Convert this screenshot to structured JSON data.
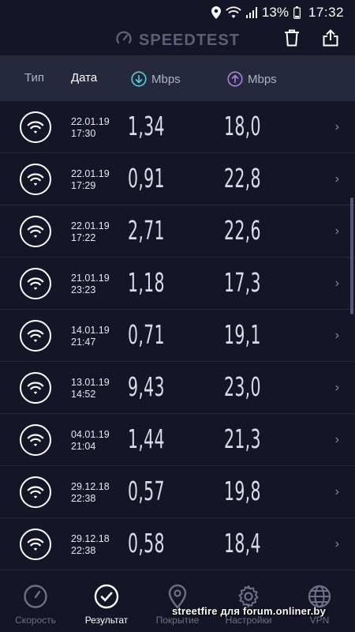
{
  "status_bar": {
    "battery": "13%",
    "time": "17:32"
  },
  "header": {
    "title": "SPEEDTEST"
  },
  "columns": {
    "type": "Тип",
    "date": "Дата",
    "download": "Mbps",
    "upload": "Mbps"
  },
  "results": [
    {
      "date": "22.01.19",
      "time": "17:30",
      "download": "1,34",
      "upload": "18,0"
    },
    {
      "date": "22.01.19",
      "time": "17:29",
      "download": "0,91",
      "upload": "22,8"
    },
    {
      "date": "22.01.19",
      "time": "17:22",
      "download": "2,71",
      "upload": "22,6"
    },
    {
      "date": "21.01.19",
      "time": "23:23",
      "download": "1,18",
      "upload": "17,3"
    },
    {
      "date": "14.01.19",
      "time": "21:47",
      "download": "0,71",
      "upload": "19,1"
    },
    {
      "date": "13.01.19",
      "time": "14:52",
      "download": "9,43",
      "upload": "23,0"
    },
    {
      "date": "04.01.19",
      "time": "21:04",
      "download": "1,44",
      "upload": "21,3"
    },
    {
      "date": "29.12.18",
      "time": "22:38",
      "download": "0,57",
      "upload": "19,8"
    },
    {
      "date": "29.12.18",
      "time": "22:38",
      "download": "0,58",
      "upload": "18,4"
    }
  ],
  "nav": [
    {
      "label": "Скорость",
      "icon": "speedometer-icon",
      "active": false
    },
    {
      "label": "Результат",
      "icon": "check-circle-icon",
      "active": true
    },
    {
      "label": "Покрытие",
      "icon": "map-pin-icon",
      "active": false
    },
    {
      "label": "Настройки",
      "icon": "gear-icon",
      "active": false
    },
    {
      "label": "VPN",
      "icon": "globe-lock-icon",
      "active": false
    }
  ],
  "watermark": "streetfire для forum.onliner.by",
  "colors": {
    "background": "#141526",
    "header_bar": "#26283d",
    "download_accent": "#4fd1d9",
    "upload_accent": "#b07fdc",
    "inactive": "#6d7088"
  }
}
